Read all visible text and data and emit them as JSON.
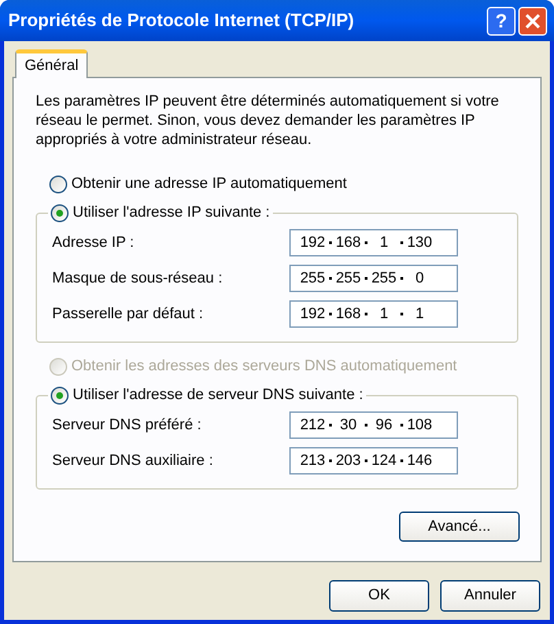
{
  "window": {
    "title": "Propriétés de Protocole Internet (TCP/IP)",
    "help_button": "?"
  },
  "tabs": [
    {
      "label": "Général",
      "selected": true
    }
  ],
  "intro": "Les paramètres IP peuvent être déterminés automatiquement si votre réseau le permet. Sinon, vous devez demander les paramètres IP appropriés à votre administrateur réseau.",
  "ip_mode": {
    "options": [
      {
        "label": "Obtenir une adresse IP automatiquement",
        "selected": false,
        "disabled": false
      },
      {
        "label": "Utiliser l'adresse IP suivante :",
        "selected": true,
        "disabled": false
      }
    ],
    "fields": [
      {
        "label": "Adresse IP :",
        "octets": [
          "192",
          "168",
          "1",
          "130"
        ]
      },
      {
        "label": "Masque de sous-réseau :",
        "octets": [
          "255",
          "255",
          "255",
          "0"
        ]
      },
      {
        "label": "Passerelle par défaut :",
        "octets": [
          "192",
          "168",
          "1",
          "1"
        ]
      }
    ]
  },
  "dns_mode": {
    "options": [
      {
        "label": "Obtenir les adresses des serveurs DNS automatiquement",
        "selected": false,
        "disabled": true
      },
      {
        "label": "Utiliser l'adresse de serveur DNS suivante :",
        "selected": true,
        "disabled": false
      }
    ],
    "fields": [
      {
        "label": "Serveur DNS préféré :",
        "octets": [
          "212",
          "30",
          "96",
          "108"
        ]
      },
      {
        "label": "Serveur DNS auxiliaire :",
        "octets": [
          "213",
          "203",
          "124",
          "146"
        ]
      }
    ]
  },
  "advanced_button": "Avancé...",
  "buttons": [
    "OK",
    "Annuler"
  ]
}
